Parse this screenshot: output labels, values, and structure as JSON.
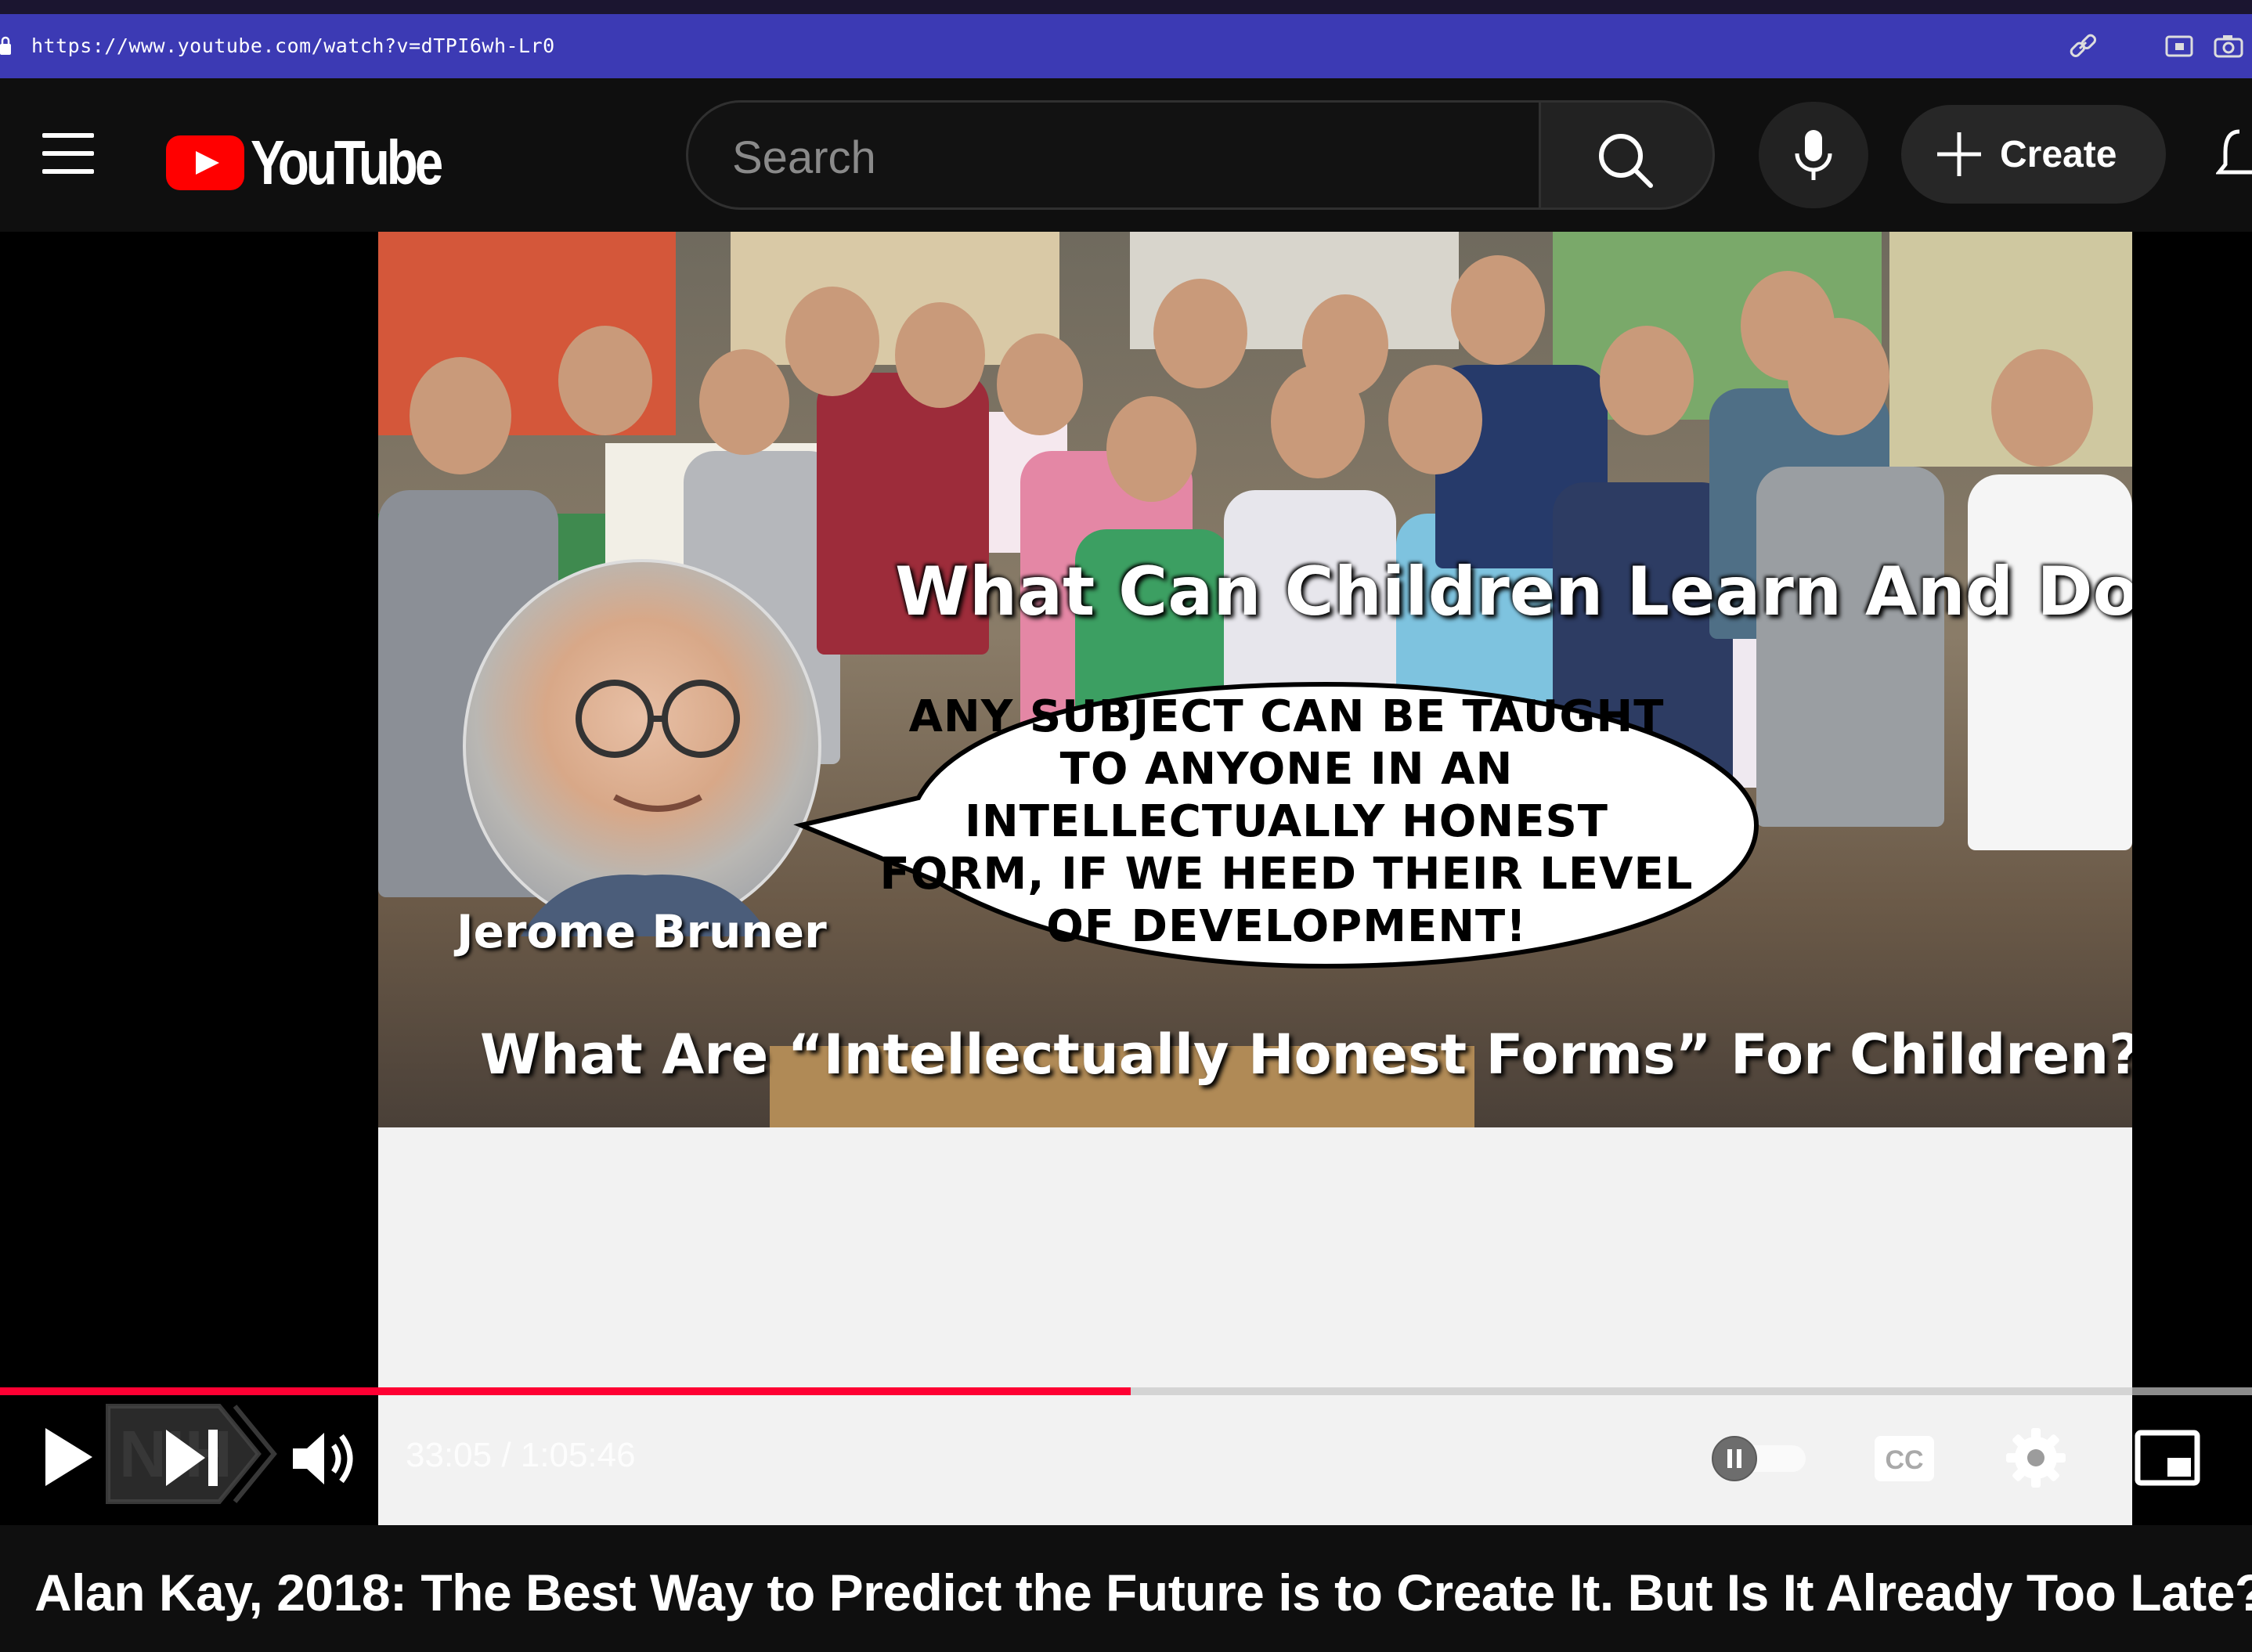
{
  "browser": {
    "url": "https://www.youtube.com/watch?v=dTPI6wh-Lr0",
    "icons": [
      "lock-icon",
      "link-icon",
      "screenshot-window-icon",
      "camera-icon"
    ]
  },
  "header": {
    "logo_text": "YouTube",
    "search_placeholder": "Search",
    "create_label": "Create",
    "icons": [
      "menu-icon",
      "search-icon",
      "mic-icon",
      "plus-icon",
      "bell-icon"
    ]
  },
  "video": {
    "slide": {
      "heading": "What Can Children Learn And Do?",
      "portrait_label": "Jerome Bruner",
      "bubble_text": "Any subject can be taught to anyone in an intellectually honest form, if we heed their level of development!",
      "footer_question": "What Are “Intellectually Honest Forms” For Children?"
    },
    "watermark": "NIH",
    "controls": {
      "time": "33:05 / 1:05:46",
      "progress": 0.502,
      "autoplay_on": false,
      "cc_label": "CC"
    },
    "title": "Alan Kay, 2018: The Best Way to Predict the Future is to Create It. But Is It Already Too Late?"
  },
  "colors": {
    "browser_bar": "#3c3ab4",
    "yt_red": "#ff0000",
    "progress_red": "#ff0033",
    "background": "#0f0f0f"
  }
}
